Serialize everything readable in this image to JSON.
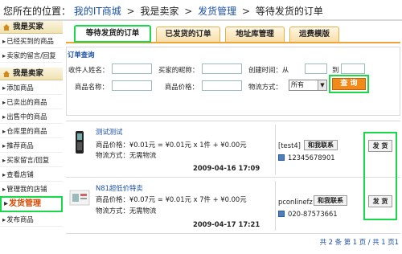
{
  "breadcrumb": {
    "prefix": "您所在的位置：",
    "items": [
      "我的IT商城",
      "我是卖家",
      "发货管理",
      "等待发货的订单"
    ],
    "sep": ">"
  },
  "sidebar": {
    "buyer_head": "我是买家",
    "buyer_items": [
      "已经买到的商品",
      "卖家的留言/回复"
    ],
    "seller_head": "我是卖家",
    "seller_items": [
      "添加商品",
      "已卖出的商品",
      "出售中的商品",
      "仓库里的商品",
      "推荐商品",
      "买家留言/回复",
      "查看店铺",
      "管理我的店铺"
    ],
    "active_item": "发货管理",
    "after_items": [
      "发布商品"
    ],
    "arrow": "▸"
  },
  "tabs": [
    "等待发货的订单",
    "已发货的订单",
    "地址库管理",
    "运费模版"
  ],
  "search": {
    "title": "订单查询",
    "recipient_label": "收件人姓名：",
    "buyer_nick_label": "买家的昵称：",
    "created_label": "创建时间：从",
    "to_label": "到",
    "product_name_label": "商品名称：",
    "product_price_label": "商品价格：",
    "ship_method_label": "物流方式：",
    "ship_method_value": "所有",
    "query_button": "查 询"
  },
  "orders": [
    {
      "name": "测试测试",
      "price_line": "商品价格：¥0.01元 = ¥0.01元 x 1件 + ¥0.00元",
      "ship_line": "物流方式：无需物流",
      "date": "2009-04-16 17:09",
      "buyer": "[test4]",
      "contact": "和我联系",
      "phone": "12345678901",
      "ship_button": "发 货"
    },
    {
      "name": "N81超低价特卖",
      "price_line": "商品价格：¥0.07元 = ¥0.01元 x 7件 + ¥0.00元",
      "ship_line": "物流方式：无需物流",
      "date": "2009-04-17 17:21",
      "buyer": "pconlinefz",
      "contact": "和我联系",
      "phone": "020-87573661",
      "ship_button": "发 货"
    }
  ],
  "pager": "共 2 条 第 1 页 / 共 1 页1",
  "colors": {
    "link": "#1a4fa5",
    "highlight": "#19d94b",
    "accent": "#f28a19",
    "tab_border": "#f0a33a"
  }
}
